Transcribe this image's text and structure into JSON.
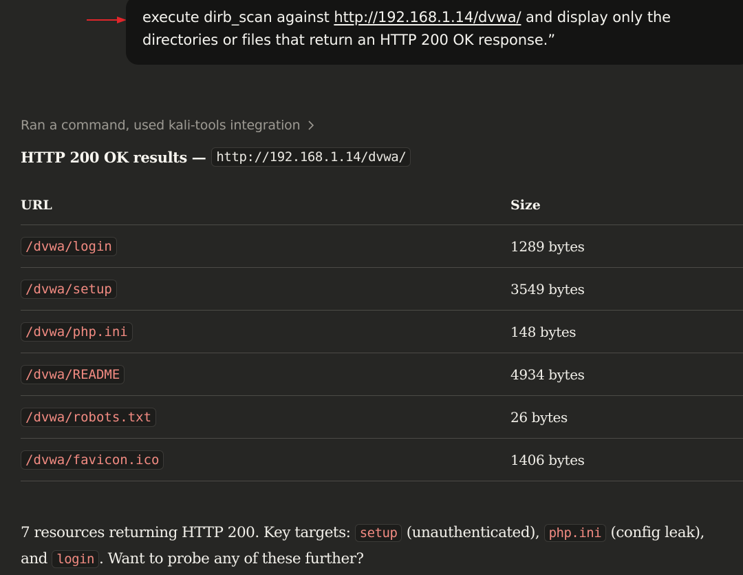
{
  "prompt": {
    "text_before": "execute dirb_scan against ",
    "link": "http://192.168.1.14/dvwa/",
    "text_after": " and display only the directories or files that return an HTTP 200 OK response.”"
  },
  "tool_use": {
    "label": "Ran a command, used kali-tools integration",
    "chevron_icon": "chevron-right-icon"
  },
  "results": {
    "heading": "HTTP 200 OK results —",
    "target_url": "http://192.168.1.14/dvwa/",
    "columns": [
      "URL",
      "Size"
    ],
    "rows": [
      {
        "url": "/dvwa/login",
        "size": "1289 bytes"
      },
      {
        "url": "/dvwa/setup",
        "size": "3549 bytes"
      },
      {
        "url": "/dvwa/php.ini",
        "size": "148 bytes"
      },
      {
        "url": "/dvwa/README",
        "size": "4934 bytes"
      },
      {
        "url": "/dvwa/robots.txt",
        "size": "26 bytes"
      },
      {
        "url": "/dvwa/favicon.ico",
        "size": "1406 bytes"
      }
    ]
  },
  "summary": {
    "part1": "7 resources returning HTTP 200. Key targets: ",
    "code1": "setup",
    "part2": " (unauthenticated), ",
    "code2": "php.ini",
    "part3": " (config leak), and ",
    "code3": "login",
    "part4": ". Want to probe any of these further?"
  },
  "colors": {
    "background": "#262624",
    "bubble": "#141413",
    "code_text": "#f28b82",
    "arrow": "#e0262b"
  }
}
